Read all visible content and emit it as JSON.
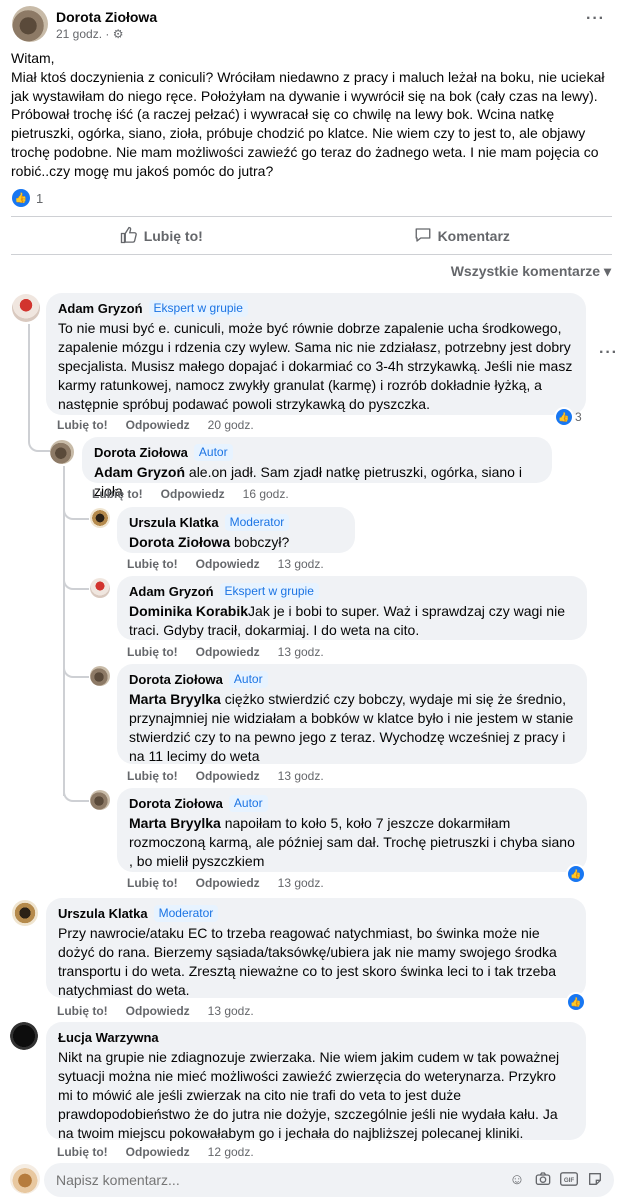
{
  "post": {
    "author": "Dorota Ziołowa",
    "time": "21 godz. · ⚙",
    "body": [
      "Witam,",
      "Miał ktoś doczynienia z coniculi? Wróciłam niedawno z pracy i maluch leżał na boku, nie uciekał jak wystawiłam do niego ręce.  Położyłam na dywanie i wywrócił się na bok (cały czas na lewy). Próbował trochę iść (a  raczej pełzać) i wywracał się co chwilę na lewy bok. Wcina natkę pietruszki, ogórka,  siano, zioła, próbuje chodzić po klatce. Nie wiem czy to jest to, ale objawy trochę podobne. Nie mam możliwości zawieźć go teraz do żadnego weta. I nie mam pojęcia co robić..czy mogę mu jakoś pomóc do jutra?"
    ],
    "reaction_count": "1"
  },
  "actions": {
    "like": "Lubię to!",
    "comment": "Komentarz"
  },
  "sort_label": "Wszystkie komentarze ▾",
  "comment_actions": {
    "like": "Lubię to!",
    "reply": "Odpowiedz"
  },
  "comments": [
    {
      "author": "Adam Gryzoń",
      "badge": "Ekspert w grupie",
      "mention": "",
      "text": "To nie musi być e. cuniculi, może być równie dobrze zapalenie ucha środkowego, zapalenie mózgu i rdzenia czy wylew. Sama nic nie zdziałasz, potrzebny jest dobry specjalista. Musisz małego dopajać i dokarmiać co 3-4h strzykawką. Jeśli nie masz karmy ratunkowej, namocz zwykły granulat (karmę) i rozrób dokładnie łyżką, a następnie spróbuj podawać powoli strzykawką do pyszczka.",
      "time": "20 godz.",
      "reactions": "3"
    },
    {
      "author": "Dorota Ziołowa",
      "badge": "Autor",
      "mention": "Adam Gryzoń",
      "text": " ale.on jadł. Sam zjadł natkę pietruszki, ogórka, siano i zioła",
      "time": "16 godz."
    },
    {
      "author": "Urszula Klatka",
      "badge": "Moderator",
      "mention": "Dorota Ziołowa",
      "text": " bobczył?",
      "time": "13 godz."
    },
    {
      "author": "Adam Gryzoń",
      "badge": "Ekspert w grupie",
      "mention": "Dominika Korabik",
      "text": "Jak je i bobi to super. Waż i sprawdzaj czy wagi nie traci. Gdyby tracił, dokarmiaj. I do weta na cito.",
      "time": "13 godz."
    },
    {
      "author": "Dorota Ziołowa",
      "badge": "Autor",
      "mention": "Marta Bryylka",
      "text": " ciężko stwierdzić czy bobczy, wydaje mi się że średnio, przynajmniej nie widziałam a bobków w klatce było i nie jestem w stanie stwierdzić czy to na pewno jego z teraz. Wychodzę wcześniej z pracy i na 11 lecimy do weta",
      "time": "13 godz."
    },
    {
      "author": "Dorota Ziołowa",
      "badge": "Autor",
      "mention": "Marta Bryylka",
      "text": " napoiłam to koło 5, koło 7 jeszcze dokarmiłam rozmoczoną karmą, ale później sam dał. Trochę pietruszki i chyba siano , bo mielił pyszczkiem",
      "time": "13 godz."
    },
    {
      "author": "Urszula Klatka",
      "badge": "Moderator",
      "mention": "",
      "text": "Przy nawrocie/ataku EC to trzeba reagować natychmiast, bo świnka może nie dożyć do rana. Bierzemy sąsiada/taksówkę/ubiera jak nie mamy swojego środka transportu i do weta. Zresztą nieważne co to jest skoro świnka leci to i tak trzeba natychmiast do weta.",
      "time": "13 godz."
    },
    {
      "author": "Łucja Warzywna",
      "badge": "",
      "mention": "",
      "text": "Nikt na grupie nie zdiagnozuje zwierzaka. Nie wiem jakim cudem w tak poważnej sytuacji można nie mieć możliwości zawieźć zwierzęcia do weterynarza. Przykro mi to mówić ale jeśli zwierzak na cito nie trafi do veta to jest duże prawdopodobieństwo że do jutra nie dożyje, szczególnie jeśli nie wydała kału. Ja na twoim miejscu pokowałabym go i jechała do najbliższej polecanej kliniki.",
      "time": "12 godz."
    }
  ],
  "composer": {
    "placeholder": "Napisz komentarz..."
  }
}
